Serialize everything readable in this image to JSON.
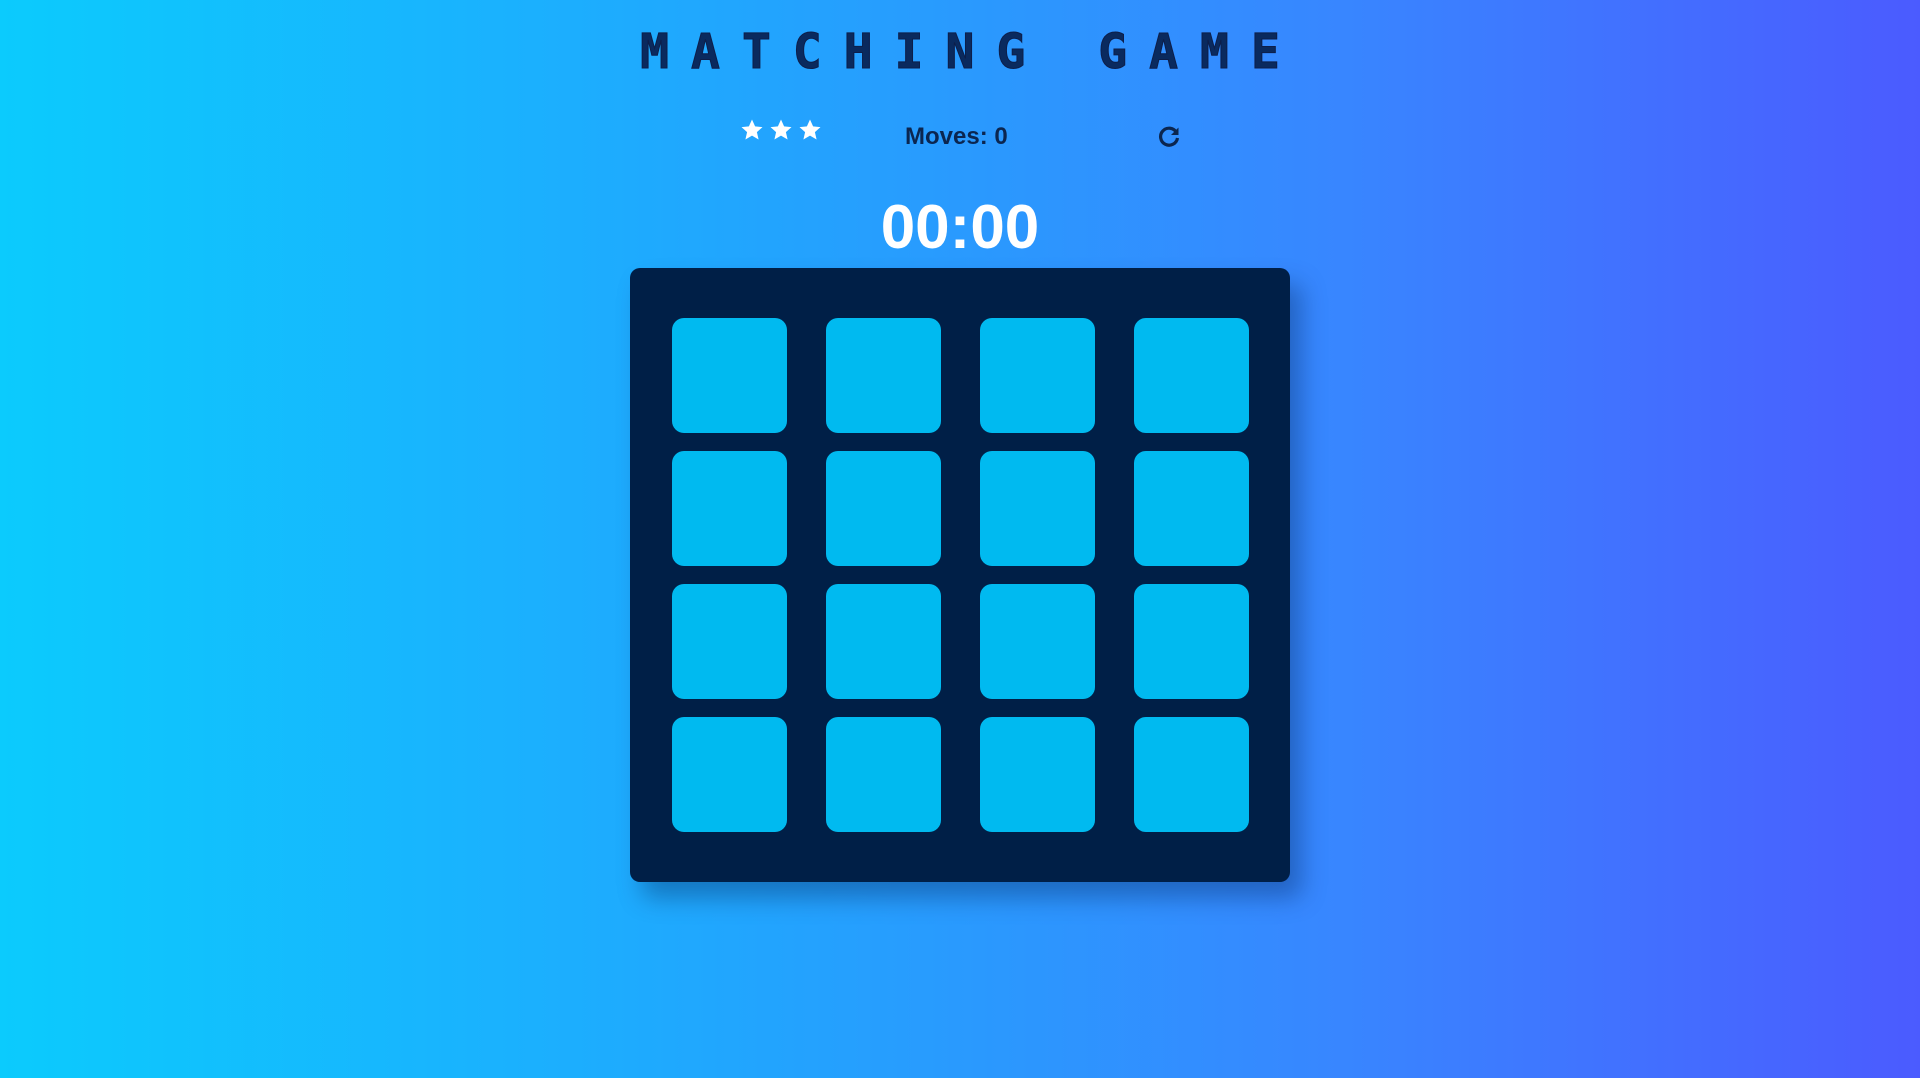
{
  "game": {
    "title": "MATCHING GAME",
    "moves_label": "Moves: 0",
    "moves": 0,
    "stars": 3,
    "timer": "00:00"
  },
  "icons": {
    "star": "star-icon",
    "restart": "restart-icon"
  },
  "colors": {
    "deck": "#001f47",
    "card_face_down": "#00baf0",
    "title": "#0a2a5e",
    "timer": "#ffffff",
    "star": "#ffffff"
  },
  "deck": {
    "rows": 4,
    "columns": 4,
    "cards": [
      {
        "state": "face-down"
      },
      {
        "state": "face-down"
      },
      {
        "state": "face-down"
      },
      {
        "state": "face-down"
      },
      {
        "state": "face-down"
      },
      {
        "state": "face-down"
      },
      {
        "state": "face-down"
      },
      {
        "state": "face-down"
      },
      {
        "state": "face-down"
      },
      {
        "state": "face-down"
      },
      {
        "state": "face-down"
      },
      {
        "state": "face-down"
      },
      {
        "state": "face-down"
      },
      {
        "state": "face-down"
      },
      {
        "state": "face-down"
      },
      {
        "state": "face-down"
      }
    ]
  }
}
